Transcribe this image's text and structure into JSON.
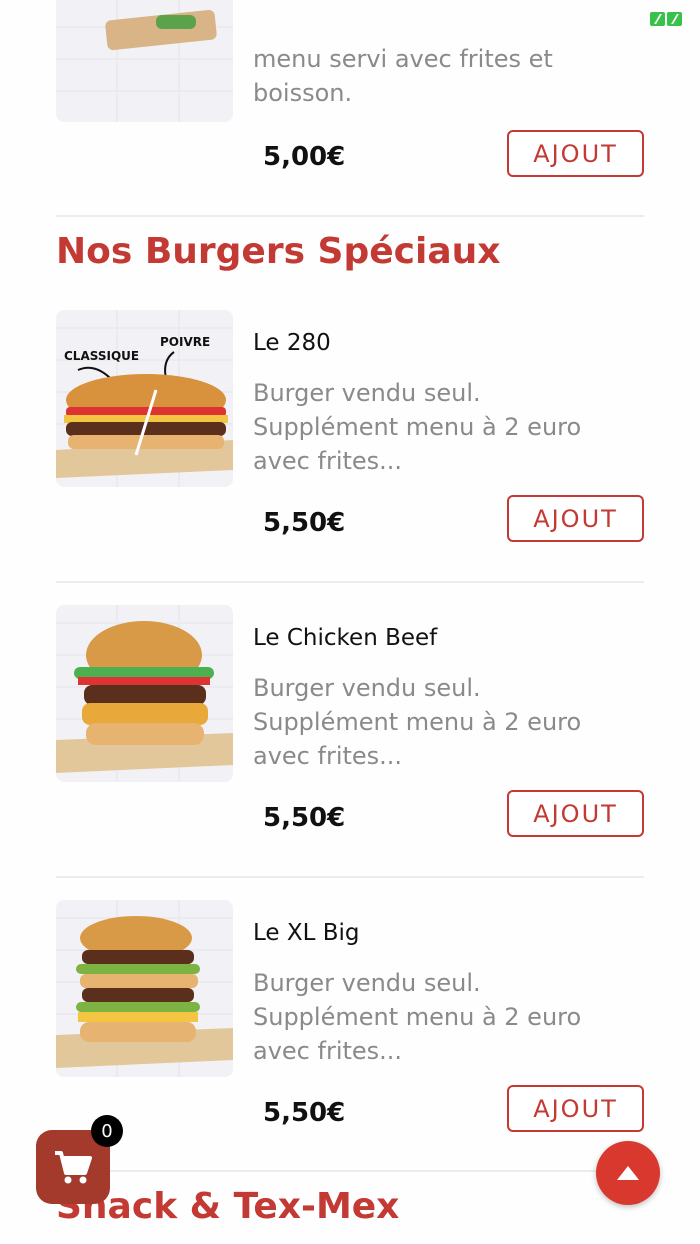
{
  "colors": {
    "accent": "#c23a33",
    "cart_bg": "#a33a2c",
    "top_btn_bg": "#d9382f"
  },
  "top_item": {
    "desc": "menu servi avec frites et boisson.",
    "price": "5,00€",
    "button": "AJOUT"
  },
  "section_burgers": {
    "title": "Nos Burgers Spéciaux"
  },
  "burgers": [
    {
      "title": "Le 280",
      "desc": "Burger vendu seul. Supplément menu à 2 euro avec frites...",
      "price": "5,50€",
      "button": "AJOUT",
      "image_labels": {
        "left": "CLASSIQUE",
        "right": "POIVRE"
      }
    },
    {
      "title": "Le Chicken Beef",
      "desc": "Burger vendu seul. Supplément menu à 2 euro avec frites...",
      "price": "5,50€",
      "button": "AJOUT"
    },
    {
      "title": "Le XL Big",
      "desc": "Burger vendu seul. Supplément menu à 2 euro avec frites...",
      "price": "5,50€",
      "button": "AJOUT"
    }
  ],
  "section_snack": {
    "title": "Snack & Tex-Mex"
  },
  "cart": {
    "count": "0",
    "icon": "cart-icon"
  },
  "scroll_top": {
    "icon": "arrow-up-icon"
  }
}
